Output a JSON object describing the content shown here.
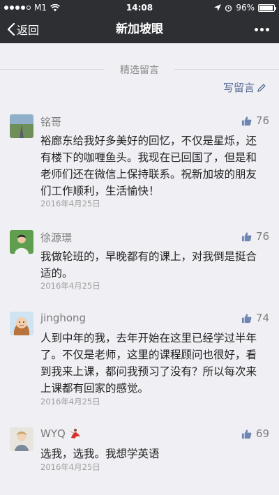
{
  "status_bar": {
    "carrier": "M1",
    "time": "14:08",
    "battery": "96%",
    "battery_level": 0.96
  },
  "nav": {
    "back_label": "返回",
    "title": "新加坡眼"
  },
  "section": {
    "title": "精选留言",
    "write_label": "写留言"
  },
  "comments": [
    {
      "nickname": "铭哥",
      "likes": "76",
      "content": "裕廊东给我好多美好的回忆，不仅是星烁，还有楼下的咖喱鱼头。我现在已回国了，但是和老师们还在微信上保持联系。祝新加坡的朋友们工作顺利，生活愉快！",
      "date": "2016年4月25日"
    },
    {
      "nickname": "徐源璟",
      "likes": "76",
      "content": "我做轮班的，早晚都有的课上，对我倒是挺合适的。",
      "date": "2016年4月25日"
    },
    {
      "nickname": "jinghong",
      "likes": "74",
      "content": "人到中年的我，去年开始在这里已经学过半年了。不仅是老师，这里的课程顾问也很好，看到我来上课，都问我预习了没有？所以每次来上课都有回家的感觉。",
      "date": "2016年4月25日"
    },
    {
      "nickname": "WYQ",
      "likes": "69",
      "content": "选我，选我。我想学英语",
      "date": "2016年4月25日"
    }
  ],
  "colors": {
    "nav_bg": "#2e2f33",
    "page_bg": "#efeff4",
    "link": "#576b95",
    "like_icon": "#6f86b3"
  }
}
